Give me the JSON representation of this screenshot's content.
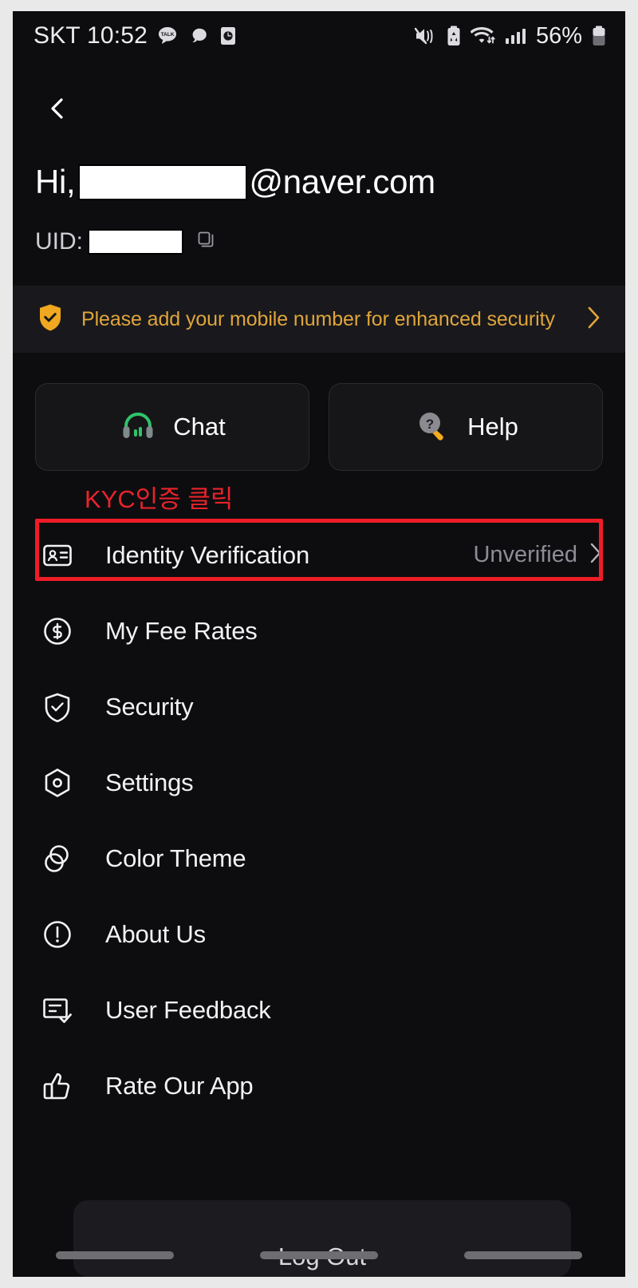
{
  "statusbar": {
    "carrier_time": "SKT 10:52",
    "battery_percent": "56%",
    "left_icons": [
      "kakaotalk-icon",
      "message-bubble-icon",
      "clock-app-icon"
    ],
    "right_icons": [
      "vibrate-mute-icon",
      "battery-saver-icon",
      "wifi-icon",
      "signal-bars-icon",
      "battery-icon"
    ]
  },
  "header": {
    "back_icon": "chevron-left-icon",
    "greeting_prefix": "Hi,",
    "email_domain": "@naver.com",
    "uid_label": "UID:",
    "copy_icon": "copy-icon",
    "redacted_username": "",
    "redacted_uid": ""
  },
  "banner": {
    "icon": "shield-check-icon",
    "text": "Please add your mobile number for enhanced security",
    "chevron": "chevron-right-icon",
    "color": "#e0a53a"
  },
  "actions": [
    {
      "label": "Chat",
      "icon": "headset-icon"
    },
    {
      "label": "Help",
      "icon": "magnifier-question-icon"
    }
  ],
  "annotation": {
    "text": "KYC인증 클릭",
    "color": "#e8232a",
    "highlight_color": "#ee1c26"
  },
  "menu": [
    {
      "label": "Identity Verification",
      "icon": "id-card-icon",
      "status": "Unverified",
      "chevron": "chevron-right-icon",
      "highlighted": true
    },
    {
      "label": "My Fee Rates",
      "icon": "dollar-circle-icon",
      "status": "",
      "chevron": "",
      "highlighted": false
    },
    {
      "label": "Security",
      "icon": "shield-check-outline-icon",
      "status": "",
      "chevron": "",
      "highlighted": false
    },
    {
      "label": "Settings",
      "icon": "hexagon-gear-icon",
      "status": "",
      "chevron": "",
      "highlighted": false
    },
    {
      "label": "Color Theme",
      "icon": "overlapping-circles-icon",
      "status": "",
      "chevron": "",
      "highlighted": false
    },
    {
      "label": "About Us",
      "icon": "exclamation-circle-icon",
      "status": "",
      "chevron": "",
      "highlighted": false
    },
    {
      "label": "User Feedback",
      "icon": "document-check-icon",
      "status": "",
      "chevron": "",
      "highlighted": false
    },
    {
      "label": "Rate Our App",
      "icon": "thumbs-up-icon",
      "status": "",
      "chevron": "",
      "highlighted": false
    }
  ],
  "footer": {
    "logout_label": "Log Out"
  }
}
